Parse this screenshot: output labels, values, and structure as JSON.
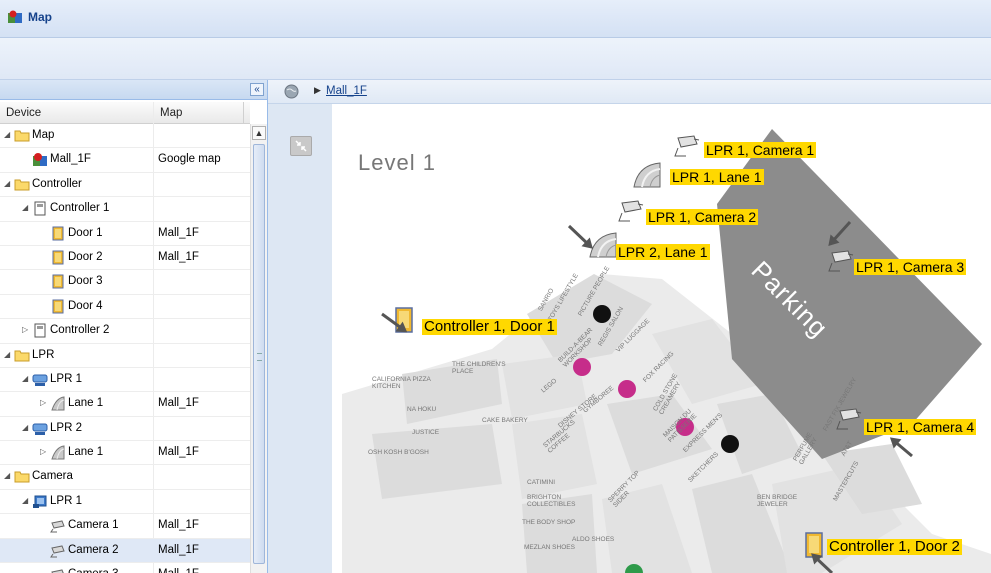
{
  "window": {
    "title": "Map"
  },
  "left": {
    "collapse_label": "«",
    "columns": {
      "device": "Device",
      "map": "Map"
    },
    "rows": [
      {
        "label": "Map",
        "map": "",
        "indent": 0,
        "icon": "folder-icon",
        "twisty": "expanded"
      },
      {
        "label": "Mall_1F",
        "map": "Google map",
        "indent": 1,
        "icon": "map-icon",
        "twisty": "none"
      },
      {
        "label": "Controller",
        "map": "",
        "indent": 0,
        "icon": "folder-icon",
        "twisty": "expanded"
      },
      {
        "label": "Controller 1",
        "map": "",
        "indent": 1,
        "icon": "controller-icon",
        "twisty": "expanded"
      },
      {
        "label": "Door 1",
        "map": "Mall_1F",
        "indent": 2,
        "icon": "door-icon",
        "twisty": "none"
      },
      {
        "label": "Door 2",
        "map": "Mall_1F",
        "indent": 2,
        "icon": "door-icon",
        "twisty": "none"
      },
      {
        "label": "Door 3",
        "map": "",
        "indent": 2,
        "icon": "door-icon",
        "twisty": "none"
      },
      {
        "label": "Door 4",
        "map": "",
        "indent": 2,
        "icon": "door-icon",
        "twisty": "none"
      },
      {
        "label": "Controller 2",
        "map": "",
        "indent": 1,
        "icon": "controller-icon",
        "twisty": "collapsed"
      },
      {
        "label": "LPR",
        "map": "",
        "indent": 0,
        "icon": "folder-icon",
        "twisty": "expanded"
      },
      {
        "label": "LPR 1",
        "map": "",
        "indent": 1,
        "icon": "lpr-icon",
        "twisty": "expanded"
      },
      {
        "label": "Lane 1",
        "map": "Mall_1F",
        "indent": 2,
        "icon": "lane-icon",
        "twisty": "collapsed"
      },
      {
        "label": "LPR 2",
        "map": "",
        "indent": 1,
        "icon": "lpr-icon",
        "twisty": "expanded"
      },
      {
        "label": "Lane 1",
        "map": "Mall_1F",
        "indent": 2,
        "icon": "lane-icon",
        "twisty": "collapsed"
      },
      {
        "label": "Camera",
        "map": "",
        "indent": 0,
        "icon": "folder-icon",
        "twisty": "expanded"
      },
      {
        "label": "LPR 1",
        "map": "",
        "indent": 1,
        "icon": "camera-group-icon",
        "twisty": "expanded"
      },
      {
        "label": "Camera 1",
        "map": "Mall_1F",
        "indent": 2,
        "icon": "camera-icon",
        "twisty": "none"
      },
      {
        "label": "Camera 2",
        "map": "Mall_1F",
        "indent": 2,
        "icon": "camera-icon",
        "twisty": "none",
        "selected": true
      },
      {
        "label": "Camera 3",
        "map": "Mall_1F",
        "indent": 2,
        "icon": "camera-icon",
        "twisty": "none"
      }
    ]
  },
  "right": {
    "breadcrumb": "Mall_1F",
    "map": {
      "level_label": "Level 1",
      "parking_label": "Parking",
      "markers": [
        {
          "label": "LPR 1, Camera 1",
          "icon": "camera-icon"
        },
        {
          "label": "LPR 1, Lane 1",
          "icon": "lane-icon"
        },
        {
          "label": "LPR 1, Camera 2",
          "icon": "camera-icon"
        },
        {
          "label": "LPR 2, Lane 1",
          "icon": "lane-icon"
        },
        {
          "label": "LPR 1, Camera 3",
          "icon": "camera-icon"
        },
        {
          "label": "Controller 1, Door 1",
          "icon": "door-icon"
        },
        {
          "label": "LPR 1, Camera 4",
          "icon": "camera-icon"
        },
        {
          "label": "Controller 1, Door 2",
          "icon": "door-icon"
        }
      ],
      "store_labels": [
        "CALIFORNIA PIZZA KITCHEN",
        "NA HOKU",
        "JUSTICE",
        "OSH KOSH B'GOSH",
        "THE CHILDREN'S PLACE",
        "GYMBOREE",
        "LEGO",
        "DISNEY STORE",
        "STARBUCKS COFFEE",
        "CAKE BAKERY",
        "SANRIO",
        "PICTURE PEOPLE",
        "REGIS SALON",
        "VIP LUGGAGE",
        "FOX RACING",
        "COLD STONE CREAMERY",
        "MAISON DU PATISSERIE",
        "EXPRESS MEN'S",
        "SKETCHERS",
        "CATIMINI",
        "BRIGHTON COLLECTIBLES",
        "THE BODY SHOP",
        "MEZLAN SHOES",
        "ALDO SHOES",
        "SPERRY TOP SIDER",
        "BEN BRIDGE JEWELER",
        "PERFUME GALLERY",
        "FAST FIX JEWELRY",
        "AT&T",
        "MASTERCUTS",
        "BUILD-A-BEAR WORKSHOP",
        "TOYS LIFESTYLE"
      ]
    }
  },
  "colors": {
    "label_bg": "#ffd800",
    "parking": "#8c8c8c",
    "tree_selected": "#dfe8f6"
  }
}
